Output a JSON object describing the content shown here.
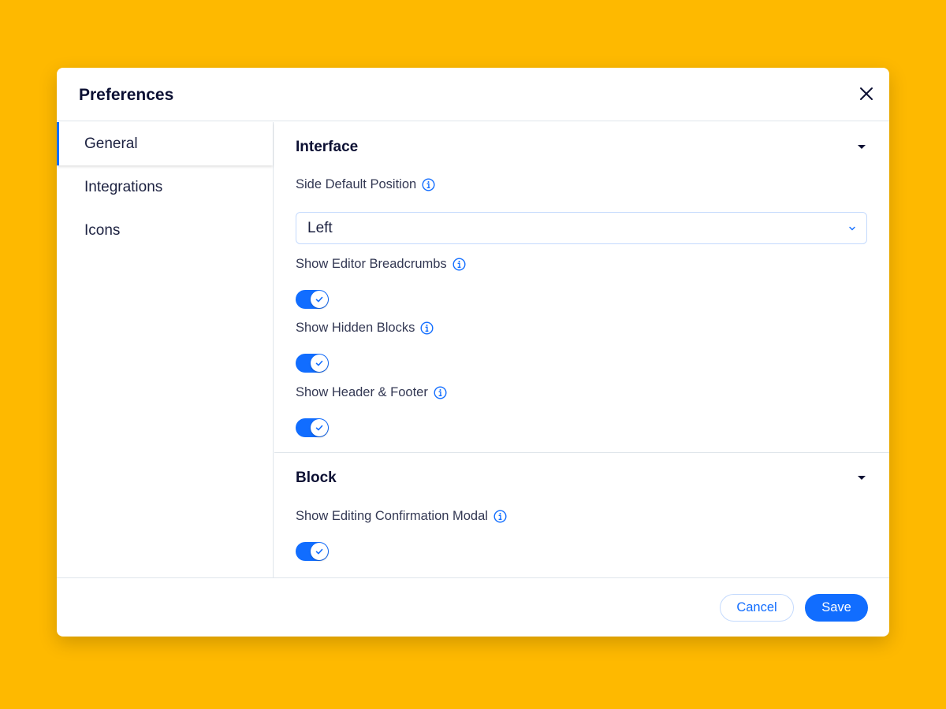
{
  "modal": {
    "title": "Preferences"
  },
  "sidebar": {
    "items": [
      {
        "label": "General"
      },
      {
        "label": "Integrations"
      },
      {
        "label": "Icons"
      }
    ]
  },
  "sections": {
    "interface": {
      "title": "Interface",
      "side_default_position": {
        "label": "Side Default Position",
        "value": "Left"
      },
      "show_editor_breadcrumbs": {
        "label": "Show Editor Breadcrumbs",
        "enabled": true
      },
      "show_hidden_blocks": {
        "label": "Show Hidden Blocks",
        "enabled": true
      },
      "show_header_footer": {
        "label": "Show Header & Footer",
        "enabled": true
      }
    },
    "block": {
      "title": "Block",
      "show_editing_confirmation_modal": {
        "label": "Show Editing Confirmation Modal",
        "enabled": true
      }
    }
  },
  "footer": {
    "cancel_label": "Cancel",
    "save_label": "Save"
  },
  "colors": {
    "background": "#FEB900",
    "accent": "#116DFF",
    "text": "#0C1033"
  },
  "icons": {
    "close": "close-icon",
    "info": "info-icon",
    "caret": "caret-down-icon",
    "chevron": "chevron-down-icon",
    "check": "check-icon"
  }
}
